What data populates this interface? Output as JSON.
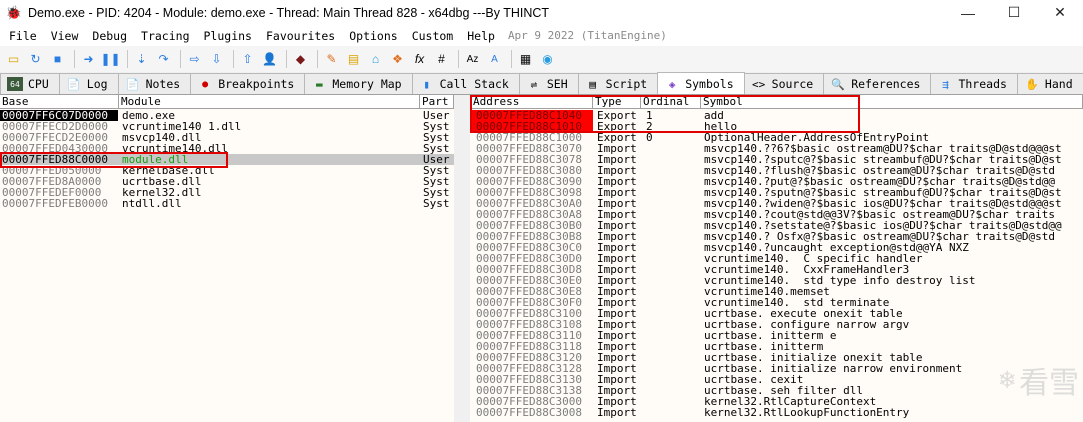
{
  "window": {
    "title": "Demo.exe - PID: 4204 - Module: demo.exe - Thread: Main Thread 828 - x64dbg   ---By THINCT",
    "controls": [
      "—",
      "☐",
      "✕"
    ]
  },
  "menu": {
    "items": [
      "File",
      "View",
      "Debug",
      "Tracing",
      "Plugins",
      "Favourites",
      "Options",
      "Custom",
      "Help"
    ],
    "date": "Apr 9 2022 (TitanEngine)"
  },
  "toolbar": {
    "icons": [
      "open-icon",
      "restart-icon",
      "stop-icon",
      "run-icon",
      "pause-icon",
      "step-into-icon",
      "step-over-icon",
      "trace-into-icon",
      "trace-over-icon",
      "execute-till-return-icon",
      "run-to-user-code-icon",
      "scylla-icon",
      "patch-icon",
      "comments-icon",
      "labels-icon",
      "bookmarks-icon",
      "function-icon",
      "variables-icon",
      "font-icon",
      "strings-icon",
      "calculator-icon",
      "settings-icon"
    ]
  },
  "tabs": [
    {
      "label": "CPU",
      "icon": "cpu-icon"
    },
    {
      "label": "Log",
      "icon": "log-icon"
    },
    {
      "label": "Notes",
      "icon": "notes-icon"
    },
    {
      "label": "Breakpoints",
      "icon": "breakpoint-dot-icon"
    },
    {
      "label": "Memory Map",
      "icon": "memory-icon"
    },
    {
      "label": "Call Stack",
      "icon": "callstack-icon"
    },
    {
      "label": "SEH",
      "icon": "seh-icon"
    },
    {
      "label": "Script",
      "icon": "script-icon"
    },
    {
      "label": "Symbols",
      "icon": "symbols-icon"
    },
    {
      "label": "Source",
      "icon": "source-icon"
    },
    {
      "label": "References",
      "icon": "references-icon"
    },
    {
      "label": "Threads",
      "icon": "threads-icon"
    },
    {
      "label": "Hand",
      "icon": "handles-icon"
    }
  ],
  "modules": {
    "headers": {
      "base": "Base",
      "module": "Module",
      "party": "Part"
    },
    "rows": [
      {
        "base": "00007FF6C07D0000",
        "module": "demo.exe",
        "party": "User"
      },
      {
        "base": "00007FFECD2D0000",
        "module": "vcruntime140_1.dll",
        "party": "Syst"
      },
      {
        "base": "00007FFECD2E0000",
        "module": "msvcp140.dll",
        "party": "Syst"
      },
      {
        "base": "00007FFED0430000",
        "module": "vcruntime140.dll",
        "party": "Syst"
      },
      {
        "base": "00007FFED88C0000",
        "module": "module.dll",
        "party": "User"
      },
      {
        "base": "00007FFED050000",
        "module": "kernelbase.dll",
        "party": "Syst"
      },
      {
        "base": "00007FFED8A0000",
        "module": "ucrtbase.dll",
        "party": "Syst"
      },
      {
        "base": "00007FFEDEF0000",
        "module": "kernel32.dll",
        "party": "Syst"
      },
      {
        "base": "00007FFEDFEB0000",
        "module": "ntdll.dll",
        "party": "Syst"
      }
    ]
  },
  "symbols": {
    "headers": {
      "address": "Address",
      "type": "Type",
      "ordinal": "Ordinal",
      "symbol": "Symbol"
    },
    "rows": [
      {
        "address": "00007FFED88C1040",
        "type": "Export",
        "ordinal": "1",
        "symbol": "add"
      },
      {
        "address": "00007FFED88C1010",
        "type": "Export",
        "ordinal": "2",
        "symbol": "hello"
      },
      {
        "address": "00007FFED88C1000",
        "type": "Export",
        "ordinal": "0",
        "symbol": "OptionalHeader.AddressOfEntryPoint"
      },
      {
        "address": "00007FFED88C3070",
        "type": "Import",
        "ordinal": "",
        "symbol": "msvcp140.??6?$basic_ostream@DU?$char_traits@D@std@@@st"
      },
      {
        "address": "00007FFED88C3078",
        "type": "Import",
        "ordinal": "",
        "symbol": "msvcp140.?sputc@?$basic_streambuf@DU?$char_traits@D@st"
      },
      {
        "address": "00007FFED88C3080",
        "type": "Import",
        "ordinal": "",
        "symbol": "msvcp140.?flush@?$basic_ostream@DU?$char_traits@D@std"
      },
      {
        "address": "00007FFED88C3090",
        "type": "Import",
        "ordinal": "",
        "symbol": "msvcp140.?put@?$basic_ostream@DU?$char_traits@D@std@@"
      },
      {
        "address": "00007FFED88C3098",
        "type": "Import",
        "ordinal": "",
        "symbol": "msvcp140.?sputn@?$basic_streambuf@DU?$char_traits@D@st"
      },
      {
        "address": "00007FFED88C30A0",
        "type": "Import",
        "ordinal": "",
        "symbol": "msvcp140.?widen@?$basic_ios@DU?$char_traits@D@std@@@st"
      },
      {
        "address": "00007FFED88C30A8",
        "type": "Import",
        "ordinal": "",
        "symbol": "msvcp140.?cout@std@@3V?$basic_ostream@DU?$char_traits"
      },
      {
        "address": "00007FFED88C30B0",
        "type": "Import",
        "ordinal": "",
        "symbol": "msvcp140.?setstate@?$basic_ios@DU?$char_traits@D@std@@"
      },
      {
        "address": "00007FFED88C30B8",
        "type": "Import",
        "ordinal": "",
        "symbol": "msvcp140.?_Osfx@?$basic_ostream@DU?$char_traits@D@std"
      },
      {
        "address": "00007FFED88C30C0",
        "type": "Import",
        "ordinal": "",
        "symbol": "msvcp140.?uncaught_exception@std@@YA_NXZ"
      },
      {
        "address": "00007FFED88C30D0",
        "type": "Import",
        "ordinal": "",
        "symbol": "vcruntime140.__C_specific_handler"
      },
      {
        "address": "00007FFED88C30D8",
        "type": "Import",
        "ordinal": "",
        "symbol": "vcruntime140.__CxxFrameHandler3"
      },
      {
        "address": "00007FFED88C30E0",
        "type": "Import",
        "ordinal": "",
        "symbol": "vcruntime140.__std_type_info_destroy_list"
      },
      {
        "address": "00007FFED88C30E8",
        "type": "Import",
        "ordinal": "",
        "symbol": "vcruntime140.memset"
      },
      {
        "address": "00007FFED88C30F0",
        "type": "Import",
        "ordinal": "",
        "symbol": "vcruntime140.__std_terminate"
      },
      {
        "address": "00007FFED88C3100",
        "type": "Import",
        "ordinal": "",
        "symbol": "ucrtbase._execute_onexit_table"
      },
      {
        "address": "00007FFED88C3108",
        "type": "Import",
        "ordinal": "",
        "symbol": "ucrtbase._configure_narrow_argv"
      },
      {
        "address": "00007FFED88C3110",
        "type": "Import",
        "ordinal": "",
        "symbol": "ucrtbase._initterm_e"
      },
      {
        "address": "00007FFED88C3118",
        "type": "Import",
        "ordinal": "",
        "symbol": "ucrtbase._initterm"
      },
      {
        "address": "00007FFED88C3120",
        "type": "Import",
        "ordinal": "",
        "symbol": "ucrtbase._initialize_onexit_table"
      },
      {
        "address": "00007FFED88C3128",
        "type": "Import",
        "ordinal": "",
        "symbol": "ucrtbase._initialize_narrow_environment"
      },
      {
        "address": "00007FFED88C3130",
        "type": "Import",
        "ordinal": "",
        "symbol": "ucrtbase._cexit"
      },
      {
        "address": "00007FFED88C3138",
        "type": "Import",
        "ordinal": "",
        "symbol": "ucrtbase._seh_filter_dll"
      },
      {
        "address": "00007FFED88C3000",
        "type": "Import",
        "ordinal": "",
        "symbol": "kernel32.RtlCaptureContext"
      },
      {
        "address": "00007FFED88C3008",
        "type": "Import",
        "ordinal": "",
        "symbol": "kernel32.RtlLookupFunctionEntry"
      }
    ]
  },
  "watermark": "看雪"
}
